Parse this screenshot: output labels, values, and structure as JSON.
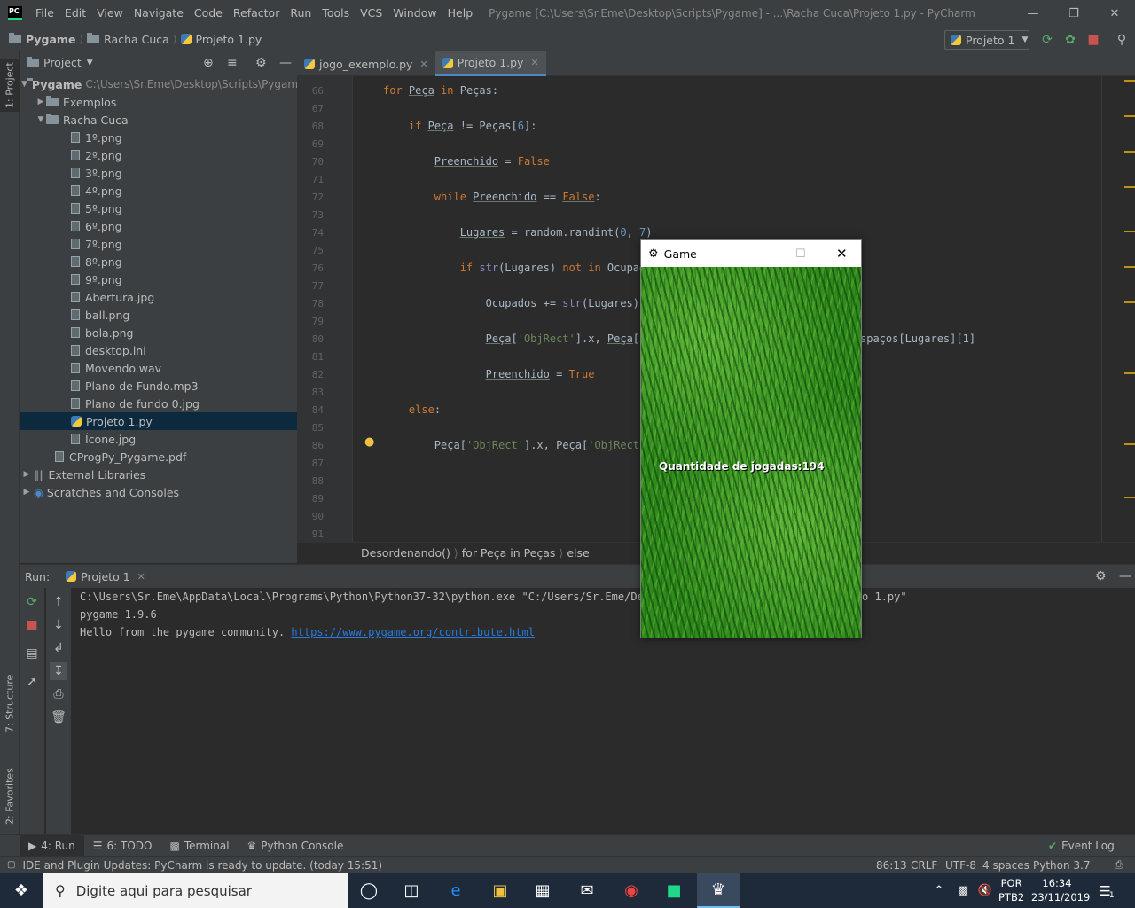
{
  "menu": {
    "items": [
      "File",
      "Edit",
      "View",
      "Navigate",
      "Code",
      "Refactor",
      "Run",
      "Tools",
      "VCS",
      "Window",
      "Help"
    ],
    "window_title": "Pygame [C:\\Users\\Sr.Eme\\Desktop\\Scripts\\Pygame] - ...\\Racha Cuca\\Projeto 1.py - PyCharm"
  },
  "navbar": {
    "crumbs": [
      "Pygame",
      "Racha Cuca",
      "Projeto 1.py"
    ],
    "run_config": "Projeto 1"
  },
  "sidebar_tabs": {
    "project": "1: Project",
    "structure": "7: Structure",
    "favorites": "2: Favorites"
  },
  "project": {
    "header": "Project",
    "root_name": "Pygame",
    "root_path": "C:\\Users\\Sr.Eme\\Desktop\\Scripts\\Pygame",
    "items": [
      "Exemplos",
      "Racha Cuca",
      "1º.png",
      "2º.png",
      "3º.png",
      "4º.png",
      "5º.png",
      "6º.png",
      "7º.png",
      "8º.png",
      "9º.png",
      "Abertura.jpg",
      "ball.png",
      "bola.png",
      "desktop.ini",
      "Movendo.wav",
      "Plano de Fundo.mp3",
      "Plano de fundo 0.jpg",
      "Projeto 1.py",
      "Ícone.jpg",
      "CProgPy_Pygame.pdf",
      "External Libraries",
      "Scratches and Consoles"
    ]
  },
  "editor": {
    "tabs": [
      "jogo_exemplo.py",
      "Projeto 1.py"
    ],
    "line_numbers": [
      "66",
      "67",
      "68",
      "69",
      "70",
      "71",
      "72",
      "73",
      "74",
      "75",
      "76",
      "77",
      "78",
      "79",
      "80",
      "81",
      "82",
      "83",
      "84",
      "85",
      "86",
      "87",
      "88",
      "89",
      "90",
      "91"
    ],
    "breadcrumb": [
      "Desordenando()",
      "for Peça in Peças",
      "else"
    ]
  },
  "run": {
    "label": "Run:",
    "tab": "Projeto 1",
    "console": [
      "C:\\Users\\Sr.Eme\\AppData\\Local\\Programs\\Python\\Python37-32\\python.exe \"C:/Users/Sr.Eme/Desk",
      "pygame 1.9.6",
      "Hello from the pygame community. "
    ],
    "console_tail": "o 1.py\"",
    "link": "https://www.pygame.org/contribute.html"
  },
  "code_fragments": {
    "l80_right": "spaços[Lugares][1]"
  },
  "bottom_tabs": [
    "4: Run",
    "6: TODO",
    "Terminal",
    "Python Console"
  ],
  "event_log": "Event Log",
  "status": {
    "message": "IDE and Plugin Updates: PyCharm is ready to update. (today 15:51)",
    "position": "86:13",
    "line_sep": "CRLF",
    "encoding": "UTF-8",
    "indent": "4 spaces",
    "interpreter": "Python 3.7"
  },
  "game": {
    "title": "Game",
    "text": "Quantidade de jogadas:194"
  },
  "taskbar": {
    "search_placeholder": "Digite aqui para pesquisar",
    "lang1": "POR",
    "lang2": "PTB2",
    "time": "16:34",
    "date": "23/11/2019",
    "notif_count": "1"
  }
}
